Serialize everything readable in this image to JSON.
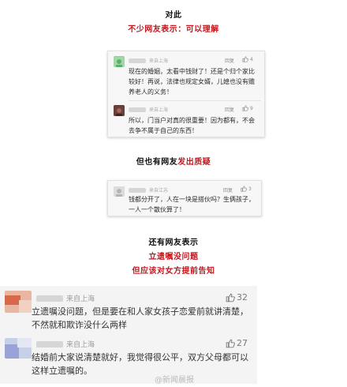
{
  "section1": {
    "title": "对此",
    "subtitle": "不少网友表示：可以理解"
  },
  "card1": {
    "comments": [
      {
        "location": "来自上海",
        "reply": "回复",
        "likes": "4",
        "text": "现在的婚姻，太看中钱财了！还是个归个家比较好！再说，法律也规定女婿，儿媳也没有赡养老人的义务！"
      },
      {
        "location": "来自上海",
        "reply": "回复",
        "likes": "9",
        "text": "所以，门当户对真的很重要！因为都有，不会去争不属于自己的东西！"
      }
    ]
  },
  "section2": {
    "title_plain": "但也有网友",
    "title_red": "发出质疑"
  },
  "card2": {
    "comment": {
      "location": "来自江苏",
      "reply": "回复",
      "likes": "3",
      "text": "钱都分开了，人在一块是搭伙吗？生俩孩子，一人一个散伙算了！"
    }
  },
  "section3": {
    "title": "还有网友表示",
    "line1": "立遗嘱没问题",
    "line2": "但应该对女方提前告知"
  },
  "card3": {
    "comments": [
      {
        "location": "来自上海",
        "likes": "32",
        "text": "立遗嘱没问题，但是要在和人家女孩子恋爱前就讲清楚，不然就和欺诈没什么两样"
      },
      {
        "location": "来自上海",
        "likes": "27",
        "text": "结婚前大家说清楚就好，我觉得很公平，双方父母都可以这样立遗嘱的。"
      }
    ]
  },
  "watermark": "@新闻晨报",
  "colors": {
    "accent_red": "#c8161d",
    "like_icon": "#8a8a8a"
  },
  "icons": [
    "thumbs-up-icon",
    "avatar-icon"
  ]
}
